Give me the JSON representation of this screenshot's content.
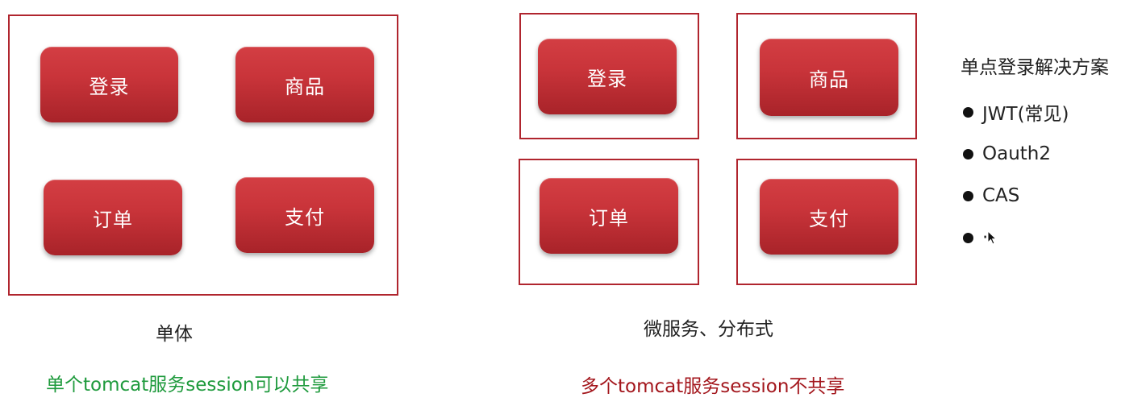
{
  "monolith": {
    "services": [
      "登录",
      "商品",
      "订单",
      "支付"
    ],
    "caption": "单体",
    "note": "单个tomcat服务session可以共享",
    "note_color": "#1e9a3c"
  },
  "distributed": {
    "services": [
      "登录",
      "商品",
      "订单",
      "支付"
    ],
    "caption": "微服务、分布式",
    "note": "多个tomcat服务session不共享",
    "note_color": "#a3161c"
  },
  "sso": {
    "title": "单点登录解决方案",
    "items": [
      "JWT(常见)",
      "Oauth2",
      "CAS",
      "·"
    ]
  },
  "colors": {
    "frame_border": "#b0252e",
    "button_fill": "#c9343a"
  }
}
